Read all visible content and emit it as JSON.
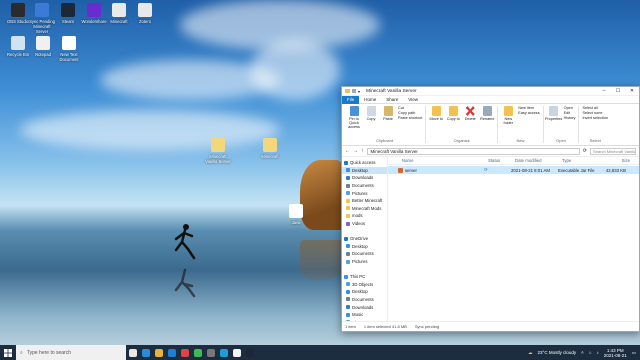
{
  "desktop": {
    "icons": [
      {
        "label": "OBS Studio",
        "color": "#2b2b2b"
      },
      {
        "label": "Sync Pending Minecraft Server",
        "color": "#3a7bd5"
      },
      {
        "label": "Steam",
        "color": "#1b2838"
      },
      {
        "label": "Wondershare",
        "color": "#6b2bd0"
      },
      {
        "label": "Minecraft",
        "color": "#e9e9e9"
      },
      {
        "label": "Zotero",
        "color": "#e8e8e8"
      },
      {
        "label": "Recycle Bin",
        "color": "#cfe3f3"
      },
      {
        "label": "Notepad",
        "color": "#f0f0f0"
      },
      {
        "label": "New Text Document",
        "color": "#ffffff"
      },
      {
        "label": "Minecraft Vanilla Server",
        "color": "#f5d77b"
      },
      {
        "label": "Minecraft",
        "color": "#f5d77b"
      },
      {
        "label": "Java",
        "color": "#ffffff"
      }
    ]
  },
  "explorer": {
    "title": "Minecraft Vanilla Server",
    "menu_tabs": [
      "File",
      "Home",
      "Share",
      "View"
    ],
    "ribbon": {
      "clipboard": {
        "label": "Clipboard",
        "pin": "Pin to Quick access",
        "copy": "Copy",
        "paste": "Paste",
        "cut": "Cut",
        "copy_path": "Copy path",
        "paste_shortcut": "Paste shortcut"
      },
      "organize": {
        "label": "Organize",
        "move_to": "Move to",
        "copy_to": "Copy to",
        "delete": "Delete",
        "rename": "Rename"
      },
      "new": {
        "label": "New",
        "new_folder": "New folder",
        "new_item": "New item",
        "easy_access": "Easy access"
      },
      "open": {
        "label": "Open",
        "properties": "Properties",
        "open": "Open",
        "edit": "Edit",
        "history": "History"
      },
      "select": {
        "label": "Select",
        "select_all": "Select all",
        "select_none": "Select none",
        "invert": "Invert selection"
      }
    },
    "address": "Minecraft Vanilla Server",
    "search_placeholder": "Search Minecraft Vanilla Server",
    "nav": [
      {
        "label": "Quick access",
        "sec": true,
        "color": "#1979ca"
      },
      {
        "label": "Desktop",
        "color": "#3a8ee6",
        "selected": true
      },
      {
        "label": "Downloads",
        "color": "#2f7fd1"
      },
      {
        "label": "Documents",
        "color": "#6d7f94"
      },
      {
        "label": "Pictures",
        "color": "#5aa0d8"
      },
      {
        "label": "Better Minecraft",
        "color": "#f2c14e"
      },
      {
        "label": "Minecraft Mods",
        "color": "#f2c14e"
      },
      {
        "label": "mods",
        "color": "#f2c14e"
      },
      {
        "label": "Videos",
        "color": "#7b61c9"
      },
      {
        "label": "",
        "color": "transparent"
      },
      {
        "label": "OneDrive",
        "sec": true,
        "color": "#1979ca"
      },
      {
        "label": "Desktop",
        "color": "#3a8ee6"
      },
      {
        "label": "Documents",
        "color": "#6d7f94"
      },
      {
        "label": "Pictures",
        "color": "#5aa0d8"
      },
      {
        "label": "",
        "color": "transparent"
      },
      {
        "label": "This PC",
        "sec": true,
        "color": "#3a8ee6"
      },
      {
        "label": "3D Objects",
        "color": "#4aa3df"
      },
      {
        "label": "Desktop",
        "color": "#3a8ee6"
      },
      {
        "label": "Documents",
        "color": "#6d7f94"
      },
      {
        "label": "Downloads",
        "color": "#2f7fd1"
      },
      {
        "label": "Music",
        "color": "#3a8ee6"
      },
      {
        "label": "Pictures",
        "color": "#5aa0d8"
      }
    ],
    "columns": {
      "name": "Name",
      "status": "Status",
      "date": "Date modified",
      "type": "Type",
      "size": "Size"
    },
    "files": [
      {
        "name": "server",
        "status": "⟳",
        "date": "2021-08-21 8:01 AM",
        "type": "Executable Jar File",
        "size": "42,833 KB"
      }
    ],
    "statusbar": {
      "items": "1 item",
      "selected": "1 item selected 41.8 MB",
      "sync": "Sync pending"
    }
  },
  "taskbar": {
    "search_placeholder": "Type here to search",
    "apps": [
      "#e8e8e8",
      "#2a8bd8",
      "#e8b33a",
      "#1e7fd7",
      "#d44",
      "#3cba54",
      "#777",
      "#1a9fd8",
      "#f4f4f4",
      "#1b2838"
    ],
    "weather": "23°C Mostly cloudy",
    "time": "1:43 PM",
    "date": "2021-08-21"
  }
}
